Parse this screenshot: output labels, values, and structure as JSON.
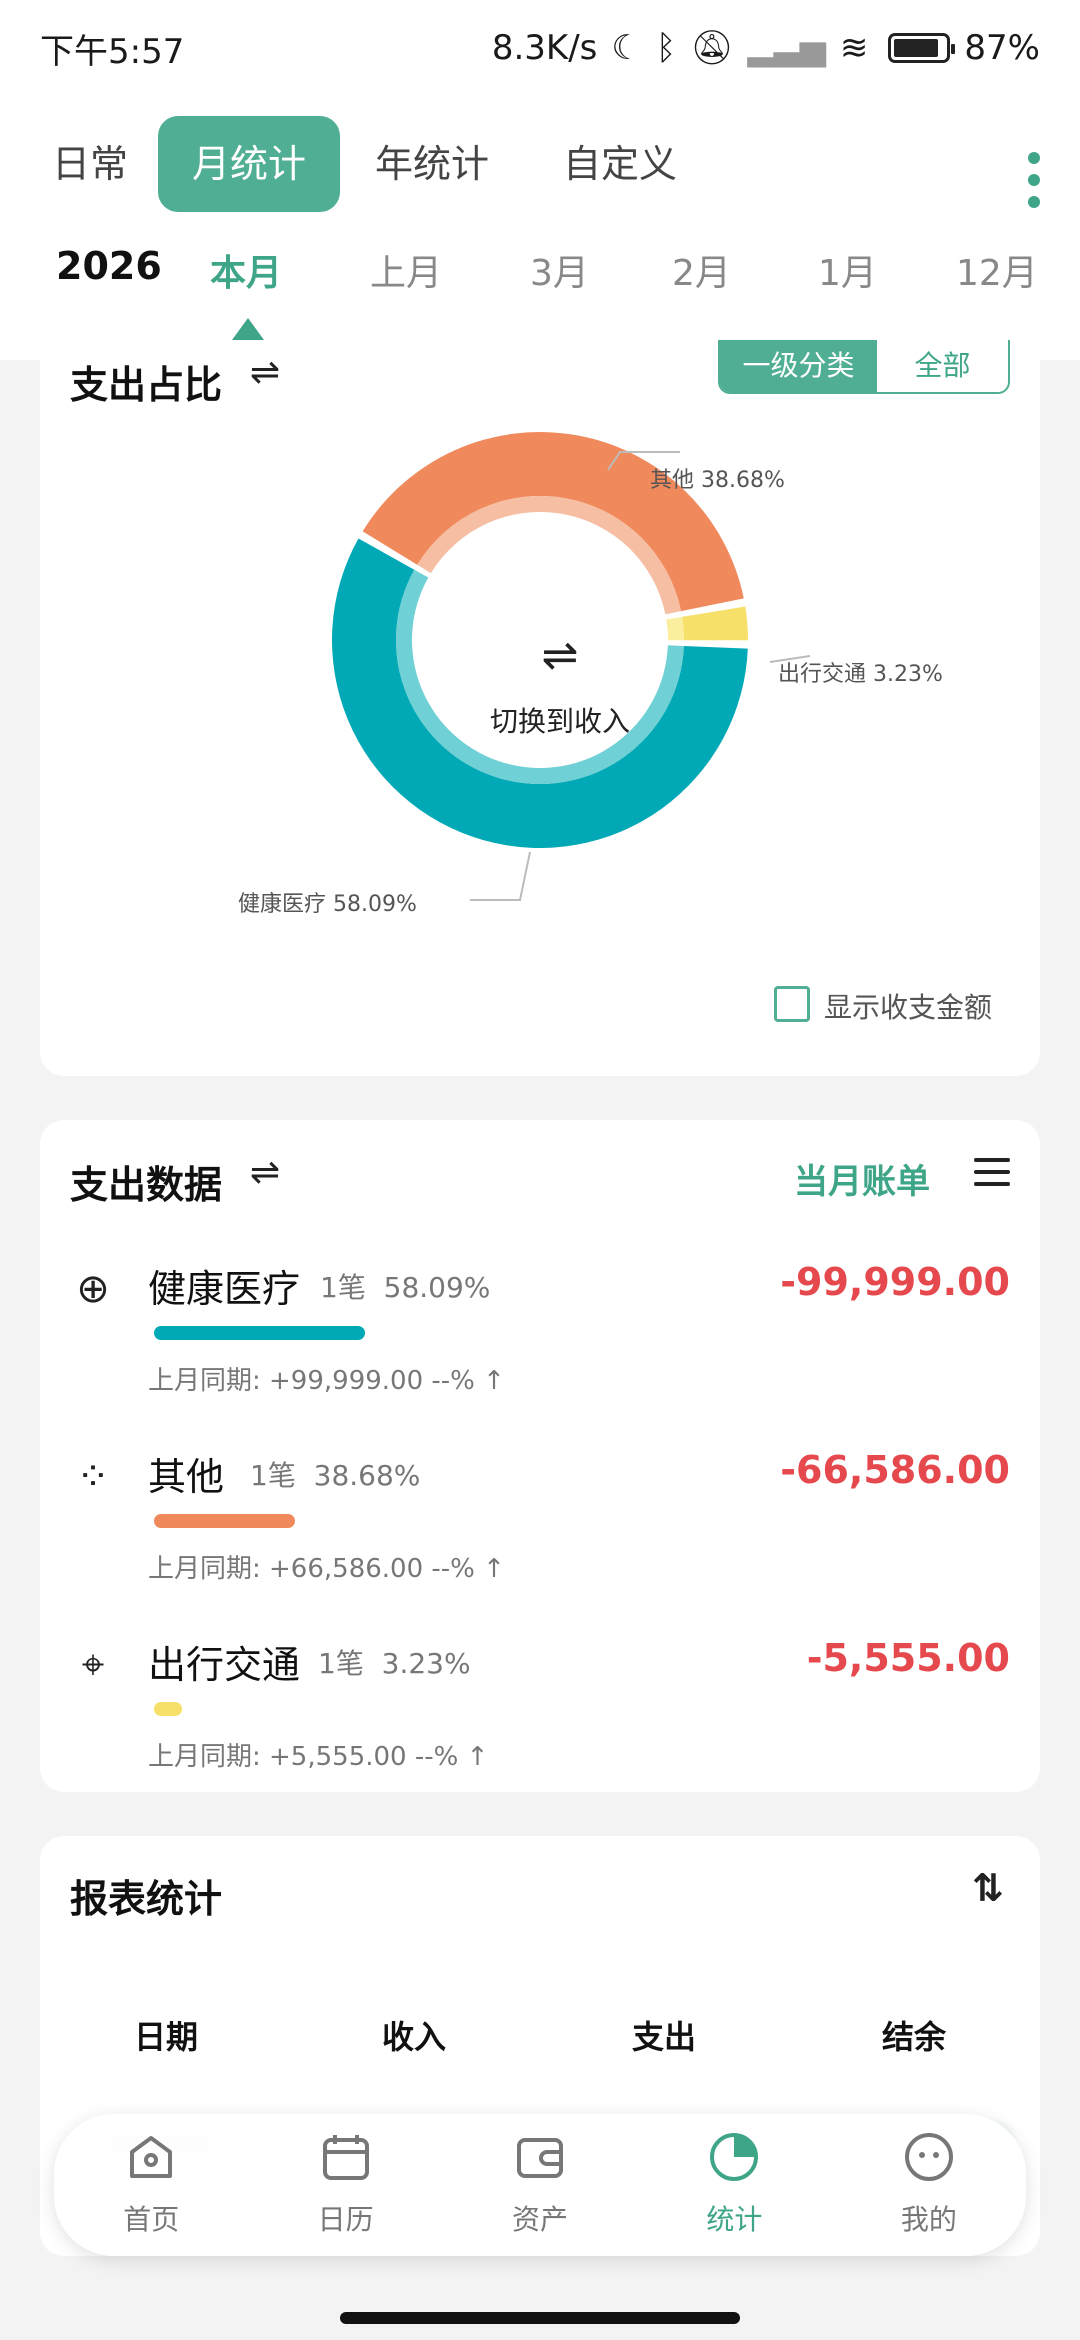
{
  "status_bar": {
    "time": "下午5:57",
    "net_speed": "8.3K/s",
    "battery": "87%"
  },
  "tabs": [
    {
      "label": "日常",
      "active": false
    },
    {
      "label": "月统计",
      "active": true
    },
    {
      "label": "年统计",
      "active": false
    },
    {
      "label": "自定义",
      "active": false
    }
  ],
  "months": {
    "year": "2026",
    "items": [
      "本月",
      "上月",
      "3月",
      "2月",
      "1月",
      "12月"
    ],
    "active_index": 0
  },
  "ratio_card": {
    "title": "支出占比",
    "seg_on": "一级分类",
    "seg_off": "全部",
    "center_label": "切换到收入",
    "checkbox_label": "显示收支金额"
  },
  "chart_data": {
    "type": "pie",
    "categories": [
      "健康医疗",
      "其他",
      "出行交通"
    ],
    "values": [
      58.09,
      38.68,
      3.23
    ],
    "labels": [
      "健康医疗 58.09%",
      "其他 38.68%",
      "出行交通 3.23%"
    ],
    "colors": [
      "#00a9b5",
      "#f08a5d",
      "#f7e06a"
    ]
  },
  "expense_card": {
    "title": "支出数据",
    "bill_link": "当月账单",
    "rows": [
      {
        "name": "健康医疗",
        "count": "1笔",
        "percent": "58.09%",
        "amount": "-99,999.00",
        "prev": "上月同期: +99,999.00  --%  ↑",
        "ratio": 0.5809,
        "color": "#00a9b5"
      },
      {
        "name": "其他",
        "count": "1笔",
        "percent": "38.68%",
        "amount": "-66,586.00",
        "prev": "上月同期: +66,586.00  --%  ↑",
        "ratio": 0.3868,
        "color": "#f08a5d"
      },
      {
        "name": "出行交通",
        "count": "1笔",
        "percent": "3.23%",
        "amount": "-5,555.00",
        "prev": "上月同期: +5,555.00  --%  ↑",
        "ratio": 0.0323,
        "color": "#f7e06a"
      }
    ]
  },
  "report_card": {
    "title": "报表统计",
    "headers": [
      "日期",
      "收入",
      "支出",
      "结余"
    ]
  },
  "bottom_nav": [
    {
      "label": "首页",
      "icon": "home-icon",
      "active": false
    },
    {
      "label": "日历",
      "icon": "calendar-icon",
      "active": false
    },
    {
      "label": "资产",
      "icon": "wallet-icon",
      "active": false
    },
    {
      "label": "统计",
      "icon": "stats-icon",
      "active": true
    },
    {
      "label": "我的",
      "icon": "profile-icon",
      "active": false
    }
  ]
}
